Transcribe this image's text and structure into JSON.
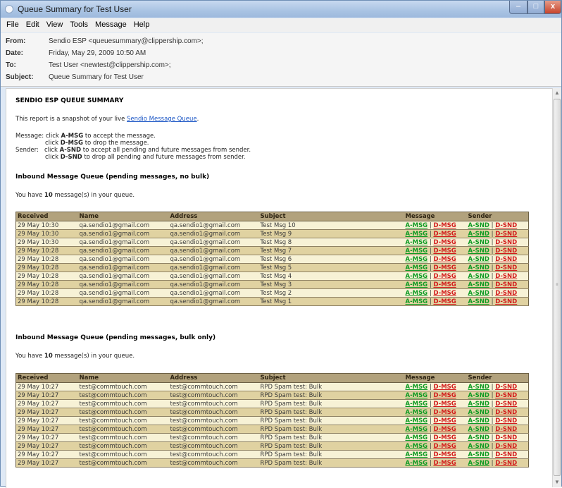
{
  "window": {
    "title": "Queue Summary for Test User",
    "caption_min": "–",
    "caption_max": "□",
    "caption_close": "x"
  },
  "menu": [
    "File",
    "Edit",
    "View",
    "Tools",
    "Message",
    "Help"
  ],
  "headers": {
    "from_label": "From:",
    "from_value": "Sendio ESP <queuesummary@clippership.com>;",
    "date_label": "Date:",
    "date_value": "Friday, May 29, 2009 10:50 AM",
    "to_label": "To:",
    "to_value": "Test User <newtest@clippership.com>;",
    "subject_label": "Subject:",
    "subject_value": "Queue Summary for Test User"
  },
  "report": {
    "title": "SENDIO ESP QUEUE SUMMARY",
    "intro_prefix": "This report is a snapshot of your live",
    "intro_link": "Sendio Message Queue",
    "intro_suffix": ".",
    "msg_label": "Message:",
    "click1": "click",
    "amsg": "A-MSG",
    "amsg_desc": "to accept the message.",
    "click2": "click",
    "dmsg": "D-MSG",
    "dmsg_desc": "to drop the message.",
    "sender_label": "Sender:",
    "click3": "click",
    "asnd": "A-SND",
    "asnd_desc": "to accept all pending and future messages from sender.",
    "click4": "click",
    "dsnd": "D-SND",
    "dsnd_desc": "to drop all pending and future messages from sender."
  },
  "columns": [
    "Received",
    "Name",
    "Address",
    "Subject",
    "Message",
    "Sender"
  ],
  "actions": {
    "amsg": "A-MSG",
    "dmsg": "D-MSG",
    "asnd": "A-SND",
    "dsnd": "D-SND",
    "sep": "|"
  },
  "queue1": {
    "heading": "Inbound Message Queue (pending messages, no bulk)",
    "count_prefix": "You have",
    "count": "10",
    "count_suffix": "message(s) in your queue.",
    "rows": [
      [
        "29 May 10:30",
        "qa.sendio1@gmail.com",
        "qa.sendio1@gmail.com",
        "Test Msg 10"
      ],
      [
        "29 May 10:30",
        "qa.sendio1@gmail.com",
        "qa.sendio1@gmail.com",
        "Test Msg 9"
      ],
      [
        "29 May 10:30",
        "qa.sendio1@gmail.com",
        "qa.sendio1@gmail.com",
        "Test Msg 8"
      ],
      [
        "29 May 10:28",
        "qa.sendio1@gmail.com",
        "qa.sendio1@gmail.com",
        "Test Msg 7"
      ],
      [
        "29 May 10:28",
        "qa.sendio1@gmail.com",
        "qa.sendio1@gmail.com",
        "Test Msg 6"
      ],
      [
        "29 May 10:28",
        "qa.sendio1@gmail.com",
        "qa.sendio1@gmail.com",
        "Test Msg 5"
      ],
      [
        "29 May 10:28",
        "qa.sendio1@gmail.com",
        "qa.sendio1@gmail.com",
        "Test Msg 4"
      ],
      [
        "29 May 10:28",
        "qa.sendio1@gmail.com",
        "qa.sendio1@gmail.com",
        "Test Msg 3"
      ],
      [
        "29 May 10:28",
        "qa.sendio1@gmail.com",
        "qa.sendio1@gmail.com",
        "Test Msg 2"
      ],
      [
        "29 May 10:28",
        "qa.sendio1@gmail.com",
        "qa.sendio1@gmail.com",
        "Test Msg 1"
      ]
    ]
  },
  "queue2": {
    "heading": "Inbound Message Queue (pending messages, bulk only)",
    "count_prefix": "You have",
    "count": "10",
    "count_suffix": "message(s) in your queue.",
    "rows": [
      [
        "29 May 10:27",
        "test@commtouch.com",
        "test@commtouch.com",
        "RPD Spam test: Bulk"
      ],
      [
        "29 May 10:27",
        "test@commtouch.com",
        "test@commtouch.com",
        "RPD Spam test: Bulk"
      ],
      [
        "29 May 10:27",
        "test@commtouch.com",
        "test@commtouch.com",
        "RPD Spam test: Bulk"
      ],
      [
        "29 May 10:27",
        "test@commtouch.com",
        "test@commtouch.com",
        "RPD Spam test: Bulk"
      ],
      [
        "29 May 10:27",
        "test@commtouch.com",
        "test@commtouch.com",
        "RPD Spam test: Bulk"
      ],
      [
        "29 May 10:27",
        "test@commtouch.com",
        "test@commtouch.com",
        "RPD Spam test: Bulk"
      ],
      [
        "29 May 10:27",
        "test@commtouch.com",
        "test@commtouch.com",
        "RPD Spam test: Bulk"
      ],
      [
        "29 May 10:27",
        "test@commtouch.com",
        "test@commtouch.com",
        "RPD Spam test: Bulk"
      ],
      [
        "29 May 10:27",
        "test@commtouch.com",
        "test@commtouch.com",
        "RPD Spam test: Bulk"
      ],
      [
        "29 May 10:27",
        "test@commtouch.com",
        "test@commtouch.com",
        "RPD Spam test: Bulk"
      ]
    ]
  }
}
